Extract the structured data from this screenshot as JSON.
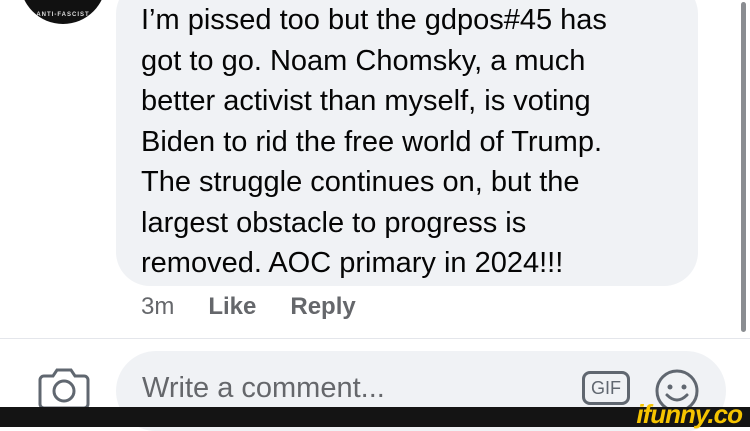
{
  "avatar": {
    "ring_text": "ANTI-FASCIST"
  },
  "comment": {
    "text": "I’m pissed too but the gdpos#45 has\ngot to go. Noam Chomsky, a much\nbetter activist than myself, is voting\nBiden to rid the free world of Trump.\nThe struggle continues on, but the\nlargest obstacle to progress is\nremoved. AOC primary in 2024!!!"
  },
  "actions": {
    "time": "3m",
    "like": "Like",
    "reply": "Reply"
  },
  "composer": {
    "placeholder": "Write a comment...",
    "camera_icon": "camera-icon",
    "gif_label": "GIF",
    "emoji_icon": "smiley-icon"
  },
  "watermark": {
    "text": "ifunny.co",
    "color": "#f5c400"
  },
  "colors": {
    "bubble": "#f0f2f5",
    "secondary_text": "#65676b"
  }
}
